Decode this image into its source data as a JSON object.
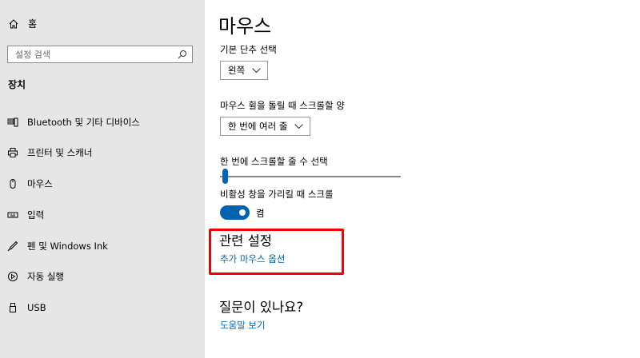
{
  "sidebar": {
    "home_label": "홈",
    "search_placeholder": "설정 검색",
    "section_title": "장치",
    "items": [
      {
        "label": "Bluetooth 및 기타 디바이스",
        "icon": "bluetooth-devices-icon"
      },
      {
        "label": "프린터 및 스캐너",
        "icon": "printer-icon"
      },
      {
        "label": "마우스",
        "icon": "mouse-icon"
      },
      {
        "label": "입력",
        "icon": "keyboard-icon"
      },
      {
        "label": "펜 및 Windows Ink",
        "icon": "pen-icon"
      },
      {
        "label": "자동 실행",
        "icon": "autoplay-icon"
      },
      {
        "label": "USB",
        "icon": "usb-icon"
      }
    ]
  },
  "main": {
    "title": "마우스",
    "primary_button": {
      "label": "기본 단추 선택",
      "value": "왼쪽"
    },
    "wheel_scroll": {
      "label": "마우스 휠을 돌릴 때 스크롤할 양",
      "value": "한 번에 여러 줄"
    },
    "lines_to_scroll": {
      "label": "한 번에 스크롤할 줄 수 선택",
      "value_fraction": 0.03
    },
    "inactive_scroll": {
      "label": "비활성 창을 가리킬 때 스크롤",
      "state": "켬",
      "on": true
    },
    "related": {
      "title": "관련 설정",
      "link": "추가 마우스 옵션"
    },
    "help": {
      "title": "질문이 있나요?",
      "link": "도움말 보기"
    }
  },
  "colors": {
    "accent": "#0063b1",
    "link": "#0066b4",
    "highlight": "#f50000",
    "sidebar_bg": "#e6e6e6"
  }
}
